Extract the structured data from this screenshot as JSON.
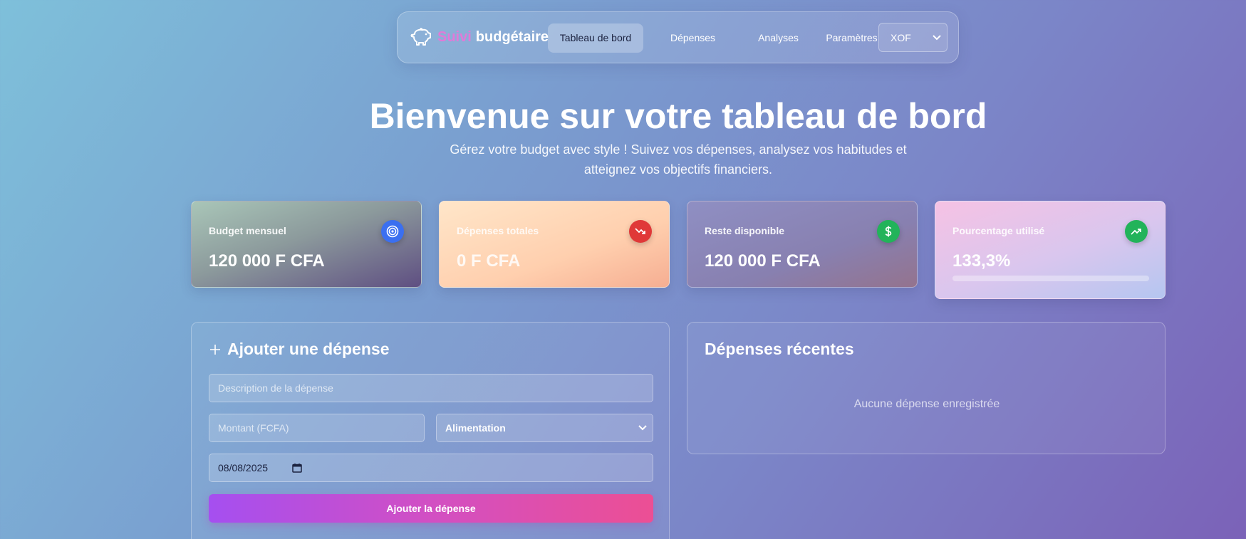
{
  "brand": {
    "word1": "Suivi",
    "word2": "budgétaire",
    "icon": "piggy-bank-icon"
  },
  "nav": {
    "links": [
      "Tableau de bord",
      "Dépenses",
      "Analyses",
      "Paramètres"
    ],
    "active": "Tableau de bord",
    "currency": "XOF"
  },
  "hero": {
    "title": "Bienvenue sur votre tableau de bord",
    "subtitle": "Gérez votre budget avec style ! Suivez vos dépenses, analysez vos habitudes et atteignez vos objectifs financiers."
  },
  "stats": [
    {
      "label": "Budget mensuel",
      "value": "120 000 F CFA",
      "icon": "target-icon",
      "icon_color": "#3b6ff0"
    },
    {
      "label": "Dépenses totales",
      "value": "0 F CFA",
      "icon": "trending-down-icon",
      "icon_color": "#e03838"
    },
    {
      "label": "Reste disponible",
      "value": "120 000 F CFA",
      "icon": "dollar-icon",
      "icon_color": "#22b35a"
    },
    {
      "label": "Pourcentage utilisé",
      "value": "133,3%",
      "icon": "trending-up-icon",
      "icon_color": "#22b35a",
      "progress": 0
    }
  ],
  "form": {
    "title": "Ajouter une dépense",
    "description_placeholder": "Description de la dépense",
    "amount_placeholder": "Montant (FCFA)",
    "category": "Alimentation",
    "date": "08/08/2025",
    "submit": "Ajouter la dépense"
  },
  "recent": {
    "title": "Dépenses récentes",
    "empty": "Aucune dépense enregistrée"
  }
}
